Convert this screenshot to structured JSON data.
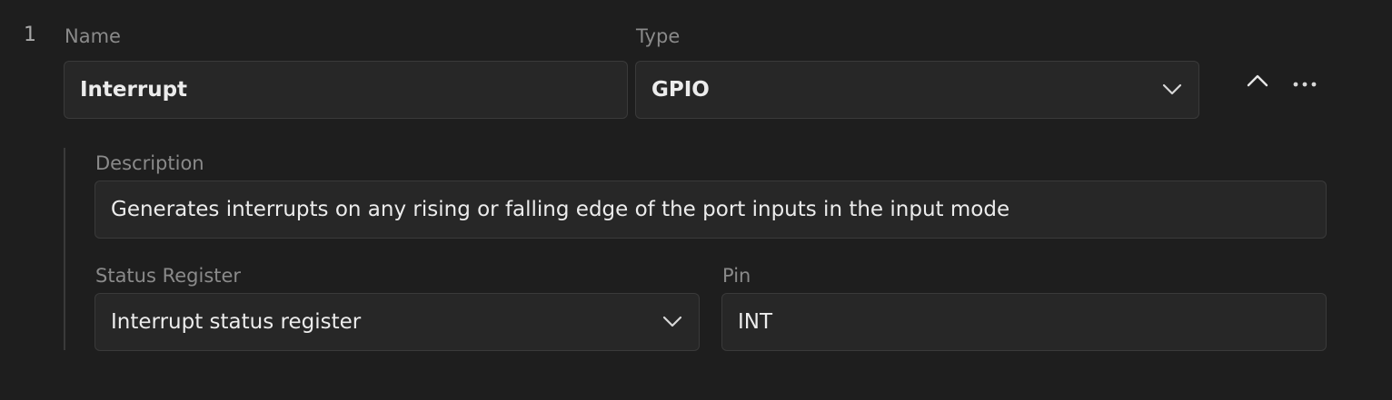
{
  "row": {
    "index": "1",
    "name": {
      "label": "Name",
      "value": "Interrupt"
    },
    "type": {
      "label": "Type",
      "value": "GPIO",
      "icon": "chevron-down-icon"
    },
    "actions": {
      "collapse_icon": "chevron-up-icon",
      "more_icon": "more-horizontal-icon"
    },
    "description": {
      "label": "Description",
      "value": "Generates interrupts on any rising or falling edge of the port inputs in the input mode"
    },
    "status_register": {
      "label": "Status Register",
      "value": "Interrupt status register",
      "icon": "chevron-down-icon"
    },
    "pin": {
      "label": "Pin",
      "value": "INT"
    }
  },
  "colors": {
    "background": "#1e1e1e",
    "field_bg": "#272727",
    "field_border": "#3a3a3a",
    "label_text": "#8a8a8a",
    "value_text": "#ececec"
  }
}
